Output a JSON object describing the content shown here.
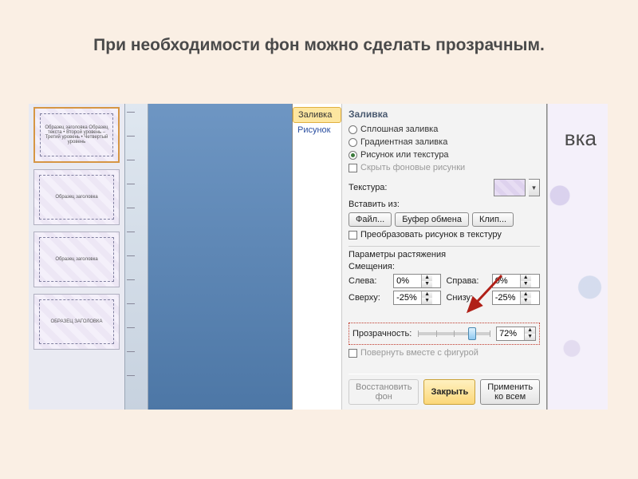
{
  "page_title": "При необходимости фон можно сделать прозрачным.",
  "thumbs": [
    {
      "label": "Образец заголовка\nОбразец текста\n• Второй уровень\n  – Третий уровень\n    • Четвертый уровень"
    },
    {
      "label": "Образец заголовка"
    },
    {
      "label": "Образец заголовка"
    },
    {
      "label": "ОБРАЗЕЦ ЗАГОЛОВКА"
    }
  ],
  "right_slide_text": "вка",
  "dialog": {
    "nav": {
      "fill": "Заливка",
      "picture": "Рисунок"
    },
    "title": "Заливка",
    "radios": {
      "solid": "Сплошная заливка",
      "gradient": "Градиентная заливка",
      "picture_texture": "Рисунок или текстура",
      "hide_bg": "Скрыть фоновые рисунки"
    },
    "texture_label": "Текстура:",
    "insert_from_label": "Вставить из:",
    "buttons": {
      "file": "Файл...",
      "clipboard": "Буфер обмена",
      "clip": "Клип..."
    },
    "tile_checkbox": "Преобразовать рисунок в текстуру",
    "stretch_group": "Параметры растяжения",
    "offsets_label": "Смещения:",
    "offsets": {
      "left_label": "Слева:",
      "left_value": "0%",
      "right_label": "Справа:",
      "right_value": "0%",
      "top_label": "Сверху:",
      "top_value": "-25%",
      "bottom_label": "Снизу:",
      "bottom_value": "-25%"
    },
    "transparency_label": "Прозрачность:",
    "transparency_value": "72%",
    "rotate_checkbox": "Повернуть вместе с фигурой",
    "footer": {
      "reset": "Восстановить фон",
      "close": "Закрыть",
      "apply_all": "Применить ко всем"
    }
  }
}
